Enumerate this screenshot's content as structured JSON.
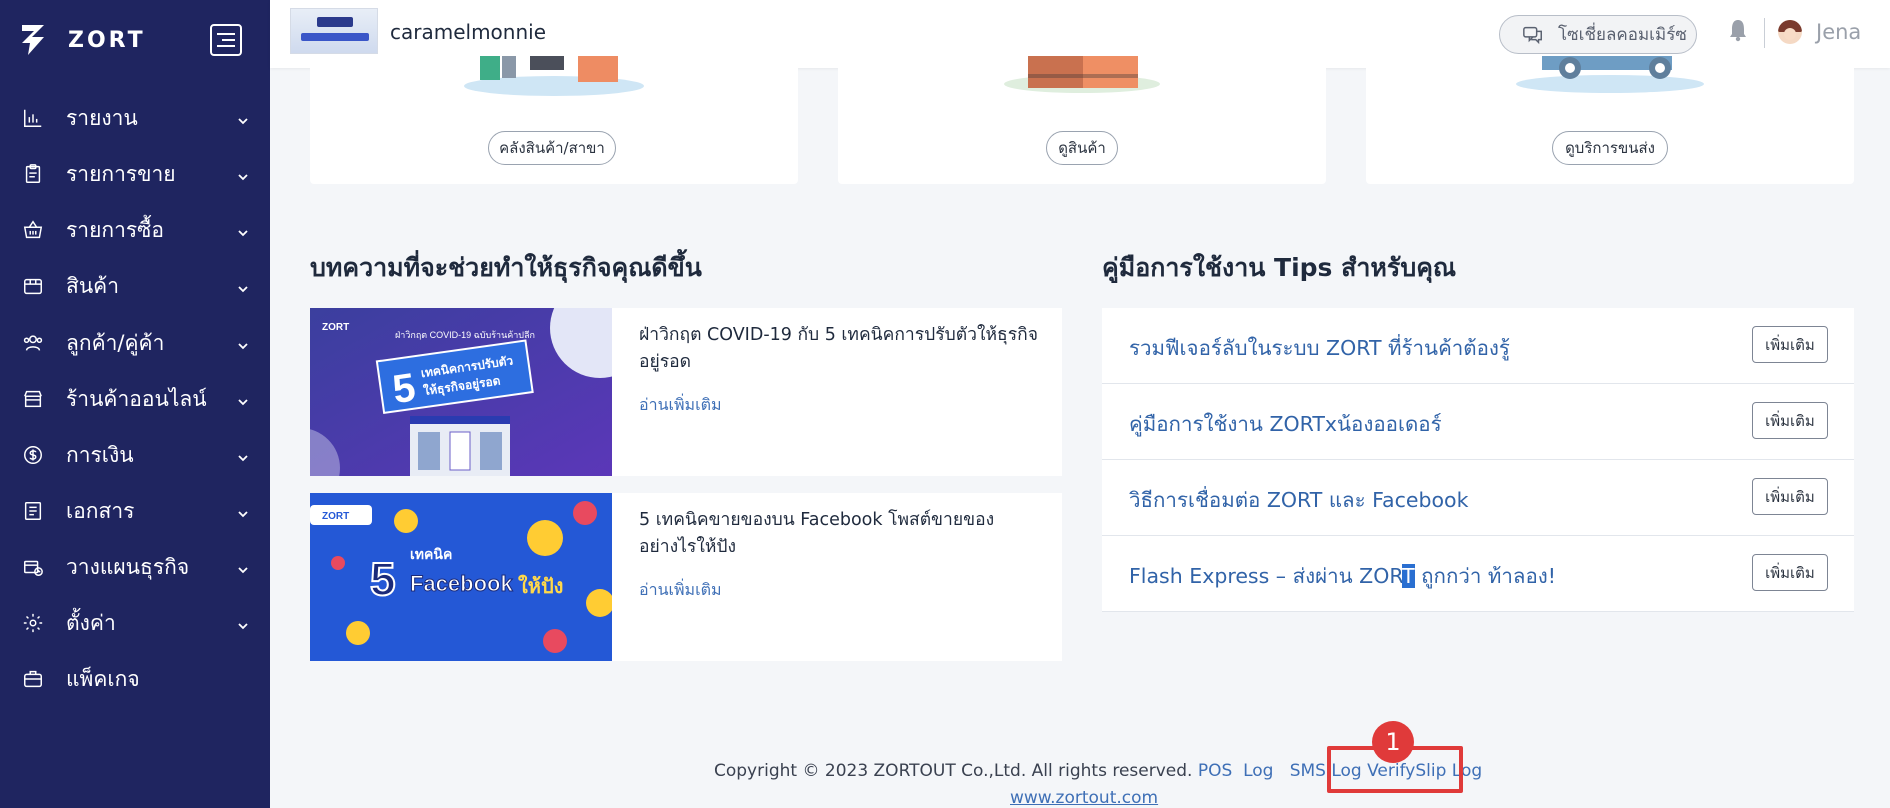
{
  "brand": {
    "name": "ZORT"
  },
  "sidebar": {
    "items": [
      {
        "label": "รายงาน",
        "icon": "bar-chart-icon",
        "has_submenu": true
      },
      {
        "label": "รายการขาย",
        "icon": "clipboard-icon",
        "has_submenu": true
      },
      {
        "label": "รายการซื้อ",
        "icon": "basket-icon",
        "has_submenu": true
      },
      {
        "label": "สินค้า",
        "icon": "box-icon",
        "has_submenu": true
      },
      {
        "label": "ลูกค้า/คู่ค้า",
        "icon": "users-icon",
        "has_submenu": true
      },
      {
        "label": "ร้านค้าออนไลน์",
        "icon": "storefront-icon",
        "has_submenu": true
      },
      {
        "label": "การเงิน",
        "icon": "dollar-icon",
        "has_submenu": true
      },
      {
        "label": "เอกสาร",
        "icon": "document-icon",
        "has_submenu": true
      },
      {
        "label": "วางแผนธุรกิจ",
        "icon": "planning-icon",
        "has_submenu": true
      },
      {
        "label": "ตั้งค่า",
        "icon": "gear-icon",
        "has_submenu": true
      },
      {
        "label": "แพ็คเกจ",
        "icon": "briefcase-icon",
        "has_submenu": false
      }
    ]
  },
  "header": {
    "shop_name": "caramelmonnie",
    "social_commerce_label": "โซเชี่ยลคอมเมิร์ซ",
    "user_name": "Jena"
  },
  "top_cards": [
    {
      "button_label": "คลังสินค้า/สาขา"
    },
    {
      "button_label": "ดูสินค้า"
    },
    {
      "button_label": "ดูบริการขนส่ง"
    }
  ],
  "articles_section": {
    "title": "บทความที่จะช่วยทำให้ธุรกิจคุณดีขึ้น",
    "items": [
      {
        "title_line1": "ฝ่าวิกฤต COVID-19 กับ 5 เทคนิคการปรับตัวให้ธุรกิจ",
        "title_line2": "อยู่รอด",
        "link_label": "อ่านเพิ่มเติม",
        "thumb_brand": "ZORT",
        "thumb_text": "ฝ่าวิกฤต COVID-19 ฉบับร้านค้าปลีก",
        "thumb_big": "5",
        "thumb_sub1": "เทคนิคการปรับตัว",
        "thumb_sub2": "ให้ธุรกิจอยู่รอด"
      },
      {
        "title_line1": "5 เทคนิคขายของบน Facebook โพสต์ขายของ",
        "title_line2": "อย่างไรให้ปัง",
        "link_label": "อ่านเพิ่มเติม",
        "thumb_brand": "ZORT",
        "thumb_big": "5",
        "thumb_sub1": "เทคนิค",
        "thumb_sub2": "Facebook",
        "thumb_sub3": "ให้ปัง"
      }
    ]
  },
  "tips_section": {
    "title": "คู่มือการใช้งาน Tips สำหรับคุณ",
    "button_label": "เพิ่มเติม",
    "items": [
      {
        "text": "รวมฟีเจอร์ลับในระบบ ZORT ที่ร้านค้าต้องรู้"
      },
      {
        "text": "คู่มือการใช้งาน ZORTxน้องออเดอร์"
      },
      {
        "text": "วิธีการเชื่อมต่อ ZORT และ Facebook"
      },
      {
        "text_before": "Flash Express – ส่งผ่าน ZOR",
        "text_highlight": "T",
        "text_after": " ถูกกว่า ท้าลอง!"
      }
    ]
  },
  "footer": {
    "copyright": "Copyright © 2023 ZORTOUT Co.,Ltd. All rights reserved.",
    "links": [
      "POS",
      "Log",
      "SMS Log",
      "VerifySlip Log"
    ],
    "url": "www.zortout.com"
  },
  "annotation": {
    "step_number": "1",
    "color": "#e03a3a"
  },
  "colors": {
    "sidebar_bg": "#1f2560",
    "link": "#3e6fb6",
    "tip_link": "#3163a8",
    "page_bg": "#f4f6f9"
  }
}
